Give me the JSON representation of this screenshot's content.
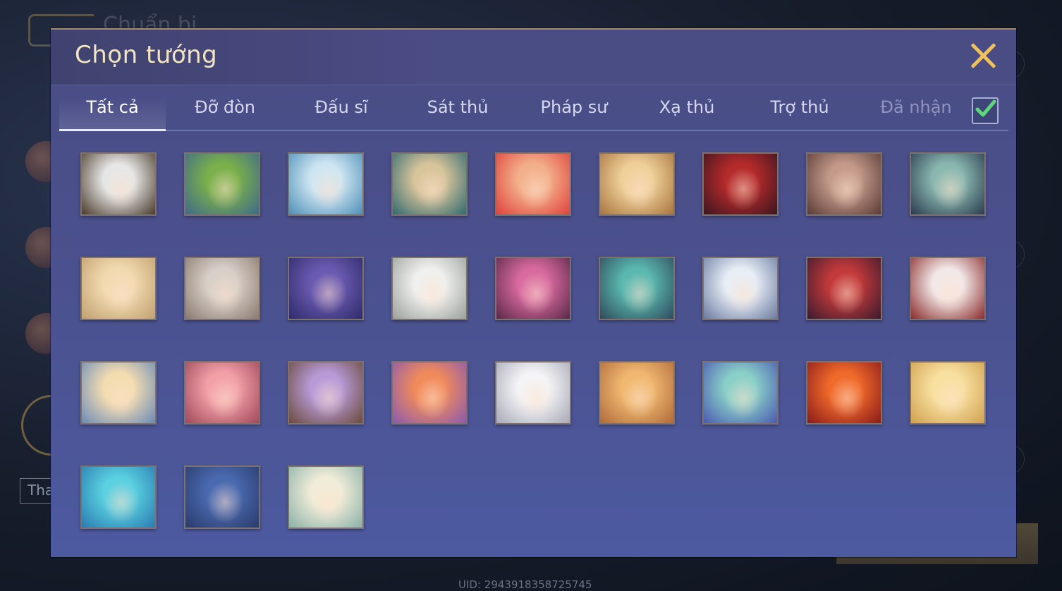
{
  "background": {
    "title": "Chuẩn bị",
    "left_button": "Tha",
    "uid": "UID: 2943918358725745"
  },
  "modal": {
    "title": "Chọn tướng",
    "tabs": [
      {
        "label": "Tất cả",
        "active": true
      },
      {
        "label": "Đỡ đòn"
      },
      {
        "label": "Đấu sĩ"
      },
      {
        "label": "Sát thủ"
      },
      {
        "label": "Pháp sư"
      },
      {
        "label": "Xạ thủ"
      },
      {
        "label": "Trợ thủ"
      },
      {
        "label": "Đã nhận",
        "muted": true
      }
    ],
    "owned_filter_checked": true
  },
  "colors": {
    "accent_gold": "#f1c25a",
    "title_text": "#f2e4c2",
    "check_green": "#5fd67a"
  },
  "heroes": [
    {
      "name": "hero-portrait-1",
      "c1": "#e6e6e6",
      "c2": "#4a3a2a"
    },
    {
      "name": "hero-portrait-2",
      "c1": "#7ab04a",
      "c2": "#3e6a8a"
    },
    {
      "name": "hero-portrait-3",
      "c1": "#cfe6f2",
      "c2": "#4e8fb8"
    },
    {
      "name": "hero-portrait-4",
      "c1": "#d8c49a",
      "c2": "#2f6a70"
    },
    {
      "name": "hero-portrait-5",
      "c1": "#f2b08a",
      "c2": "#e0413c"
    },
    {
      "name": "hero-portrait-6",
      "c1": "#f0d09a",
      "c2": "#a8743e"
    },
    {
      "name": "hero-portrait-7",
      "c1": "#b52a2a",
      "c2": "#3a1620"
    },
    {
      "name": "hero-portrait-8",
      "c1": "#c49a8a",
      "c2": "#5a3a36"
    },
    {
      "name": "hero-portrait-9",
      "c1": "#8ab8b0",
      "c2": "#2a3a4e"
    },
    {
      "name": "hero-portrait-10",
      "c1": "#f2dab0",
      "c2": "#c0a070"
    },
    {
      "name": "hero-portrait-11",
      "c1": "#d8cfc8",
      "c2": "#8a7a70"
    },
    {
      "name": "hero-portrait-12",
      "c1": "#6a5ab0",
      "c2": "#2e2a6a"
    },
    {
      "name": "hero-portrait-13",
      "c1": "#f0f0ee",
      "c2": "#9aa09a"
    },
    {
      "name": "hero-portrait-14",
      "c1": "#d86aa0",
      "c2": "#5a2848"
    },
    {
      "name": "hero-portrait-15",
      "c1": "#5ab8b0",
      "c2": "#2e4a5a"
    },
    {
      "name": "hero-portrait-16",
      "c1": "#e8eef6",
      "c2": "#6a7aa0"
    },
    {
      "name": "hero-portrait-17",
      "c1": "#c23a3a",
      "c2": "#3a1a2e"
    },
    {
      "name": "hero-portrait-18",
      "c1": "#f2e8e8",
      "c2": "#8a2a2a"
    },
    {
      "name": "hero-portrait-19",
      "c1": "#f2dcb0",
      "c2": "#6a8ab8"
    },
    {
      "name": "hero-portrait-20",
      "c1": "#f2a0a8",
      "c2": "#a0485a"
    },
    {
      "name": "hero-portrait-21",
      "c1": "#b89ad8",
      "c2": "#6a4a3a"
    },
    {
      "name": "hero-portrait-22",
      "c1": "#f08a5a",
      "c2": "#8a5ab0"
    },
    {
      "name": "hero-portrait-23",
      "c1": "#f4f4f6",
      "c2": "#a8a8b8"
    },
    {
      "name": "hero-portrait-24",
      "c1": "#f0b870",
      "c2": "#b06a3a"
    },
    {
      "name": "hero-portrait-25",
      "c1": "#8ad0c8",
      "c2": "#4a5ab0"
    },
    {
      "name": "hero-portrait-26",
      "c1": "#f06a2a",
      "c2": "#8a1a1a"
    },
    {
      "name": "hero-portrait-27",
      "c1": "#f8e0a0",
      "c2": "#d0a050"
    },
    {
      "name": "hero-portrait-28",
      "c1": "#5ad0e0",
      "c2": "#2a7ab0"
    },
    {
      "name": "hero-portrait-29",
      "c1": "#4a6ab0",
      "c2": "#2a3a6a"
    },
    {
      "name": "hero-portrait-30",
      "c1": "#f0ecd8",
      "c2": "#8ab0a8"
    }
  ]
}
